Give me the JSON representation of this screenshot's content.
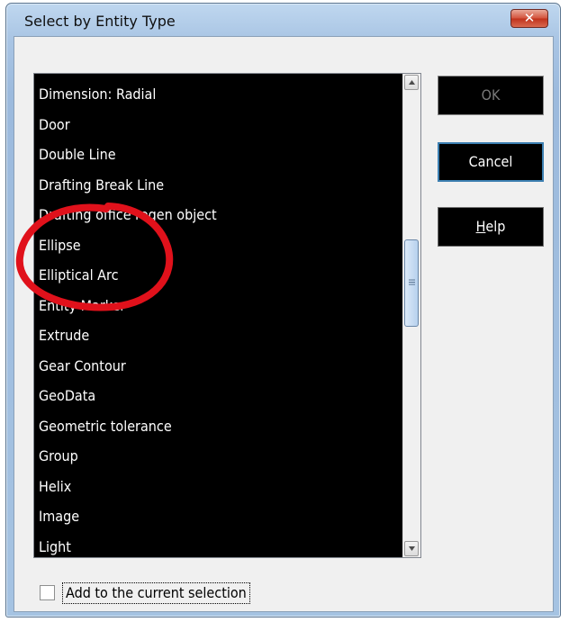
{
  "dialog": {
    "title": "Select by Entity Type",
    "close_icon": "close-icon",
    "close_glyph": "✕"
  },
  "entity_list": {
    "items": [
      "Dimension: Radial",
      "Door",
      "Double Line",
      "Drafting Break Line",
      "Drafting office regen object",
      "Ellipse",
      "Elliptical Arc",
      "Entity Marker",
      "Extrude",
      "Gear Contour",
      "GeoData",
      "Geometric tolerance",
      "Group",
      "Helix",
      "Image",
      "Light"
    ],
    "scroll_position": 0.44
  },
  "buttons": {
    "ok_label": "OK",
    "cancel_label": "Cancel",
    "help_mnemonic": "H",
    "help_rest": "elp"
  },
  "options": {
    "add_to_selection_label": "Add to the current selection",
    "add_to_selection_checked": false
  },
  "annotation": {
    "shape": "circle",
    "color": "#e0111b"
  }
}
